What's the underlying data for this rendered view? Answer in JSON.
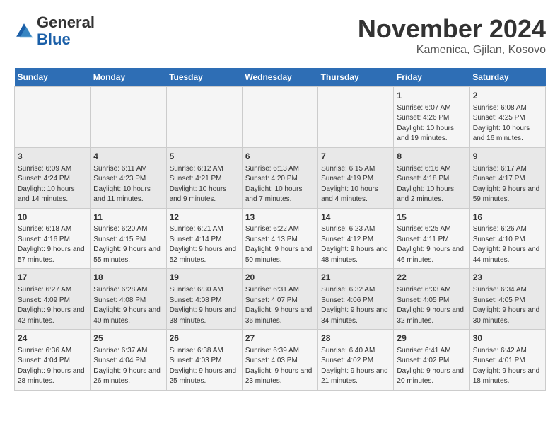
{
  "logo": {
    "general": "General",
    "blue": "Blue"
  },
  "title": "November 2024",
  "subtitle": "Kamenica, Gjilan, Kosovo",
  "days_of_week": [
    "Sunday",
    "Monday",
    "Tuesday",
    "Wednesday",
    "Thursday",
    "Friday",
    "Saturday"
  ],
  "weeks": [
    [
      {
        "day": "",
        "info": ""
      },
      {
        "day": "",
        "info": ""
      },
      {
        "day": "",
        "info": ""
      },
      {
        "day": "",
        "info": ""
      },
      {
        "day": "",
        "info": ""
      },
      {
        "day": "1",
        "info": "Sunrise: 6:07 AM\nSunset: 4:26 PM\nDaylight: 10 hours and 19 minutes."
      },
      {
        "day": "2",
        "info": "Sunrise: 6:08 AM\nSunset: 4:25 PM\nDaylight: 10 hours and 16 minutes."
      }
    ],
    [
      {
        "day": "3",
        "info": "Sunrise: 6:09 AM\nSunset: 4:24 PM\nDaylight: 10 hours and 14 minutes."
      },
      {
        "day": "4",
        "info": "Sunrise: 6:11 AM\nSunset: 4:23 PM\nDaylight: 10 hours and 11 minutes."
      },
      {
        "day": "5",
        "info": "Sunrise: 6:12 AM\nSunset: 4:21 PM\nDaylight: 10 hours and 9 minutes."
      },
      {
        "day": "6",
        "info": "Sunrise: 6:13 AM\nSunset: 4:20 PM\nDaylight: 10 hours and 7 minutes."
      },
      {
        "day": "7",
        "info": "Sunrise: 6:15 AM\nSunset: 4:19 PM\nDaylight: 10 hours and 4 minutes."
      },
      {
        "day": "8",
        "info": "Sunrise: 6:16 AM\nSunset: 4:18 PM\nDaylight: 10 hours and 2 minutes."
      },
      {
        "day": "9",
        "info": "Sunrise: 6:17 AM\nSunset: 4:17 PM\nDaylight: 9 hours and 59 minutes."
      }
    ],
    [
      {
        "day": "10",
        "info": "Sunrise: 6:18 AM\nSunset: 4:16 PM\nDaylight: 9 hours and 57 minutes."
      },
      {
        "day": "11",
        "info": "Sunrise: 6:20 AM\nSunset: 4:15 PM\nDaylight: 9 hours and 55 minutes."
      },
      {
        "day": "12",
        "info": "Sunrise: 6:21 AM\nSunset: 4:14 PM\nDaylight: 9 hours and 52 minutes."
      },
      {
        "day": "13",
        "info": "Sunrise: 6:22 AM\nSunset: 4:13 PM\nDaylight: 9 hours and 50 minutes."
      },
      {
        "day": "14",
        "info": "Sunrise: 6:23 AM\nSunset: 4:12 PM\nDaylight: 9 hours and 48 minutes."
      },
      {
        "day": "15",
        "info": "Sunrise: 6:25 AM\nSunset: 4:11 PM\nDaylight: 9 hours and 46 minutes."
      },
      {
        "day": "16",
        "info": "Sunrise: 6:26 AM\nSunset: 4:10 PM\nDaylight: 9 hours and 44 minutes."
      }
    ],
    [
      {
        "day": "17",
        "info": "Sunrise: 6:27 AM\nSunset: 4:09 PM\nDaylight: 9 hours and 42 minutes."
      },
      {
        "day": "18",
        "info": "Sunrise: 6:28 AM\nSunset: 4:08 PM\nDaylight: 9 hours and 40 minutes."
      },
      {
        "day": "19",
        "info": "Sunrise: 6:30 AM\nSunset: 4:08 PM\nDaylight: 9 hours and 38 minutes."
      },
      {
        "day": "20",
        "info": "Sunrise: 6:31 AM\nSunset: 4:07 PM\nDaylight: 9 hours and 36 minutes."
      },
      {
        "day": "21",
        "info": "Sunrise: 6:32 AM\nSunset: 4:06 PM\nDaylight: 9 hours and 34 minutes."
      },
      {
        "day": "22",
        "info": "Sunrise: 6:33 AM\nSunset: 4:05 PM\nDaylight: 9 hours and 32 minutes."
      },
      {
        "day": "23",
        "info": "Sunrise: 6:34 AM\nSunset: 4:05 PM\nDaylight: 9 hours and 30 minutes."
      }
    ],
    [
      {
        "day": "24",
        "info": "Sunrise: 6:36 AM\nSunset: 4:04 PM\nDaylight: 9 hours and 28 minutes."
      },
      {
        "day": "25",
        "info": "Sunrise: 6:37 AM\nSunset: 4:04 PM\nDaylight: 9 hours and 26 minutes."
      },
      {
        "day": "26",
        "info": "Sunrise: 6:38 AM\nSunset: 4:03 PM\nDaylight: 9 hours and 25 minutes."
      },
      {
        "day": "27",
        "info": "Sunrise: 6:39 AM\nSunset: 4:03 PM\nDaylight: 9 hours and 23 minutes."
      },
      {
        "day": "28",
        "info": "Sunrise: 6:40 AM\nSunset: 4:02 PM\nDaylight: 9 hours and 21 minutes."
      },
      {
        "day": "29",
        "info": "Sunrise: 6:41 AM\nSunset: 4:02 PM\nDaylight: 9 hours and 20 minutes."
      },
      {
        "day": "30",
        "info": "Sunrise: 6:42 AM\nSunset: 4:01 PM\nDaylight: 9 hours and 18 minutes."
      }
    ]
  ]
}
